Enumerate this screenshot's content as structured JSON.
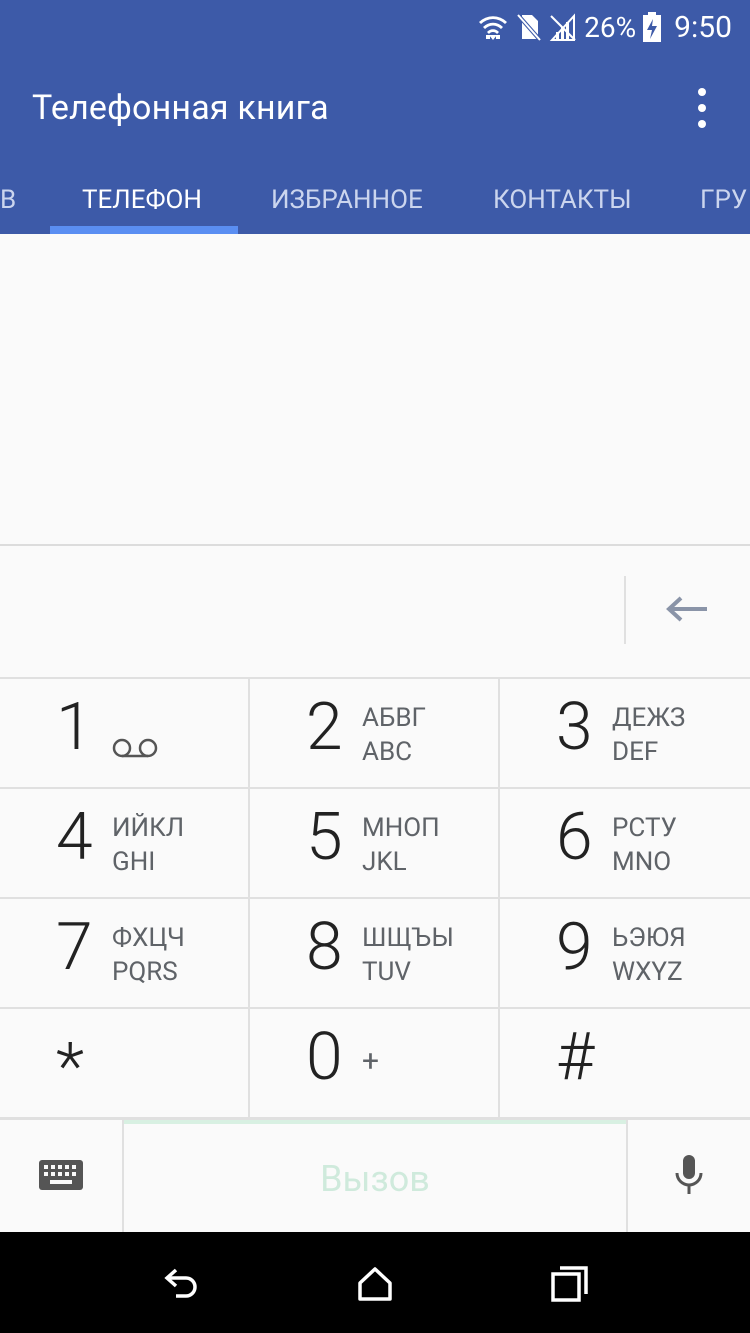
{
  "status": {
    "battery": "26%",
    "time": "9:50"
  },
  "app": {
    "title": "Телефонная книга"
  },
  "tabs": [
    {
      "label": "В"
    },
    {
      "label": "ТЕЛЕФОН"
    },
    {
      "label": "ИЗБРАННОЕ"
    },
    {
      "label": "КОНТАКТЫ"
    },
    {
      "label": "ГРУ"
    }
  ],
  "keypad": [
    {
      "digit": "1",
      "line1": "",
      "line2": ""
    },
    {
      "digit": "2",
      "line1": "АБВГ",
      "line2": "ABC"
    },
    {
      "digit": "3",
      "line1": "ДЕЖЗ",
      "line2": "DEF"
    },
    {
      "digit": "4",
      "line1": "ИЙКЛ",
      "line2": "GHI"
    },
    {
      "digit": "5",
      "line1": "МНОП",
      "line2": "JKL"
    },
    {
      "digit": "6",
      "line1": "РСТУ",
      "line2": "MNO"
    },
    {
      "digit": "7",
      "line1": "ФХЦЧ",
      "line2": "PQRS"
    },
    {
      "digit": "8",
      "line1": "ШЩЪЫ",
      "line2": "TUV"
    },
    {
      "digit": "9",
      "line1": "ЬЭЮЯ",
      "line2": "WXYZ"
    },
    {
      "digit": "*",
      "line1": "",
      "line2": ""
    },
    {
      "digit": "0",
      "line1": "+",
      "line2": ""
    },
    {
      "digit": "#",
      "line1": "",
      "line2": ""
    }
  ],
  "call": {
    "label": "Вызов"
  },
  "colors": {
    "appbar": "#3d5aa8",
    "indicator": "#5a8ef2",
    "call_text": "#cfeadc"
  },
  "icons": [
    "wifi-icon",
    "no-sim-icon",
    "signal-icon",
    "battery-charging-icon",
    "menu-icon",
    "backspace-icon",
    "voicemail-icon",
    "keyboard-icon",
    "microphone-icon",
    "back-icon",
    "home-icon",
    "recents-icon"
  ]
}
